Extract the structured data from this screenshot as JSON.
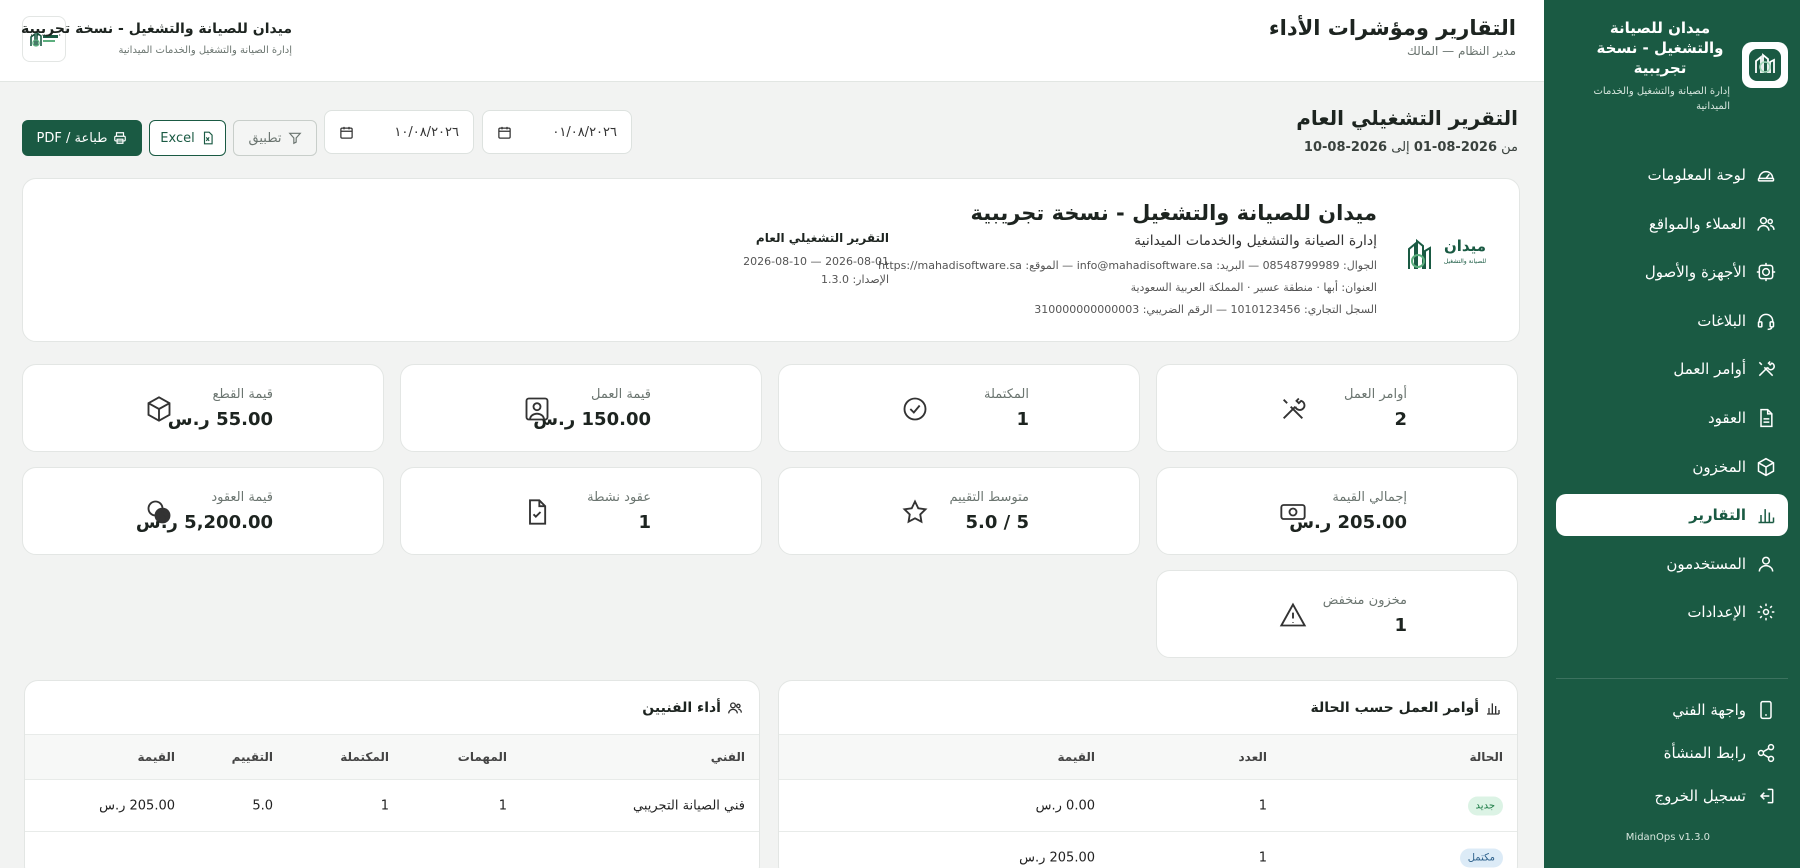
{
  "sidebar": {
    "brand_title": "ميدان للصيانة والتشغيل - نسخة تجريبية",
    "brand_subtitle": "إدارة الصيانة والتشغيل والخدمات الميدانية",
    "items": [
      {
        "label": "لوحة المعلومات",
        "icon": "dashboard-icon",
        "active": false
      },
      {
        "label": "العملاء والمواقع",
        "icon": "users-icon",
        "active": false
      },
      {
        "label": "الأجهزة والأصول",
        "icon": "device-icon",
        "active": false
      },
      {
        "label": "البلاغات",
        "icon": "headset-icon",
        "active": false
      },
      {
        "label": "أوامر العمل",
        "icon": "tools-icon",
        "active": false
      },
      {
        "label": "العقود",
        "icon": "document-icon",
        "active": false
      },
      {
        "label": "المخزون",
        "icon": "box-icon",
        "active": false
      },
      {
        "label": "التقارير",
        "icon": "chart-icon",
        "active": true
      },
      {
        "label": "المستخدمون",
        "icon": "user-icon",
        "active": false
      },
      {
        "label": "الإعدادات",
        "icon": "gear-icon",
        "active": false
      }
    ],
    "bottom": [
      {
        "label": "واجهة الفني",
        "icon": "phone-icon"
      },
      {
        "label": "رابط المنشأة",
        "icon": "share-icon"
      },
      {
        "label": "تسجيل الخروج",
        "icon": "logout-icon"
      }
    ],
    "version": "MidanOps v1.3.0"
  },
  "topbar": {
    "title": "التقارير ومؤشرات الأداء",
    "role": "مدير النظام — المالك",
    "org_name": "ميدان للصيانة والتشغيل - نسخة تجريبية",
    "org_subtitle": "إدارة الصيانة والتشغيل والخدمات الميدانية"
  },
  "header": {
    "title": "التقرير التشغيلي العام",
    "range_prefix": "من",
    "range_from": "2026-08-01",
    "range_mid": "إلى",
    "range_to": "2026-08-10"
  },
  "toolbar": {
    "date_from": "٠١/٠٨/٢٠٢٦",
    "date_to": "١٠/٠٨/٢٠٢٦",
    "apply_label": "تطبيق",
    "excel_label": "Excel",
    "print_label": "طباعة / PDF"
  },
  "org_card": {
    "logo_text": "ميدان",
    "logo_sub": "للصيانة والتشغيل",
    "name": "ميدان للصيانة والتشغيل - نسخة تجريبية",
    "subtitle": "إدارة الصيانة والتشغيل والخدمات الميدانية",
    "contact_line": "الجوال: 08548799989 — البريد: info@mahadisoftware.sa — الموقع: https://mahadisoftware.sa",
    "address_line": "العنوان: أبها · منطقة عسير · المملكة العربية السعودية",
    "registry_line": "السجل التجاري: 1010123456 — الرقم الضريبي: 310000000000003",
    "report_title": "التقرير التشغيلي العام",
    "report_range": "2026-08-01 — 2026-08-10",
    "report_version": "الإصدار: 1.3.0"
  },
  "stats": [
    {
      "label": "أوامر العمل",
      "value": "2",
      "icon": "tools-icon"
    },
    {
      "label": "المكتملة",
      "value": "1",
      "icon": "check-circle-icon"
    },
    {
      "label": "قيمة العمل",
      "value": "150.00 ر.س",
      "icon": "worker-icon"
    },
    {
      "label": "قيمة القطع",
      "value": "55.00 ر.س",
      "icon": "box-icon"
    },
    {
      "label": "إجمالي القيمة",
      "value": "205.00 ر.س",
      "icon": "cash-icon"
    },
    {
      "label": "متوسط التقييم",
      "value": "5 / 5.0",
      "icon": "star-icon"
    },
    {
      "label": "عقود نشطة",
      "value": "1",
      "icon": "file-check-icon"
    },
    {
      "label": "قيمة العقود",
      "value": "5,200.00 ر.س",
      "icon": "coins-icon"
    },
    {
      "label": "مخزون منخفض",
      "value": "1",
      "icon": "warning-icon"
    }
  ],
  "wo_table": {
    "title": "أوامر العمل حسب الحالة",
    "columns": [
      "الحالة",
      "العدد",
      "القيمة"
    ],
    "rows": [
      {
        "status": "جديد",
        "count": "1",
        "value": "0.00 ر.س"
      },
      {
        "status": "مكتمل",
        "count": "1",
        "value": "205.00 ر.س"
      }
    ]
  },
  "tech_table": {
    "title": "أداء الفنيين",
    "columns": [
      "الفني",
      "المهمات",
      "المكتملة",
      "التقييم",
      "القيمة"
    ],
    "rows": [
      {
        "name": "فني الصيانة التجريبي",
        "tasks": "1",
        "done": "1",
        "rating": "5.0",
        "value": "205.00 ر.س"
      }
    ]
  },
  "colors": {
    "primary": "#1a5a43",
    "background": "#f2f3f2"
  }
}
